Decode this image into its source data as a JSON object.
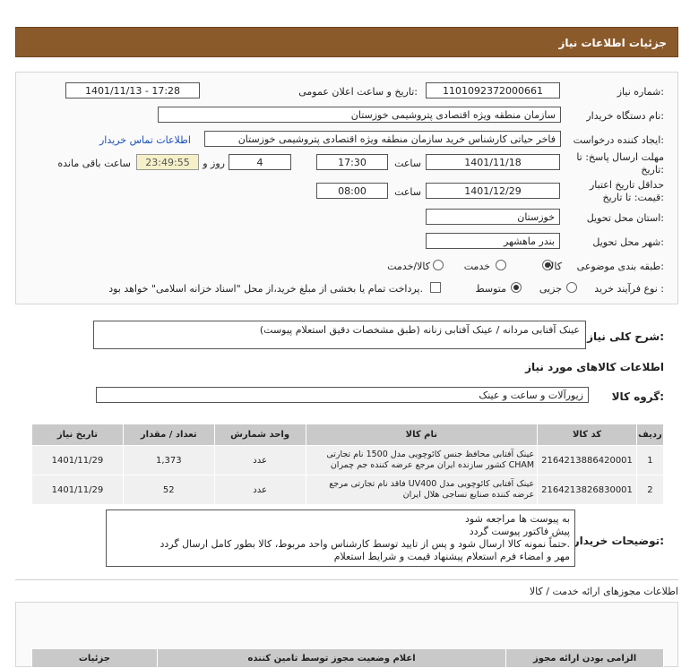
{
  "page": {
    "title": "جزئیات اطلاعات نیاز"
  },
  "form": {
    "need_number_label": "شماره نیاز:",
    "need_number": "1101092372000661",
    "announce_label": "تاریخ و ساعت اعلان عمومی:",
    "announce_value": "1401/11/13 - 17:28",
    "buyer_label": "نام دستگاه خریدار:",
    "buyer": "سازمان منطقه ویژه اقتصادی پتروشیمی خوزستان",
    "creator_label": "ایجاد کننده درخواست:",
    "creator": "فاخر حیاتی کارشناس خرید سازمان منطقه ویژه اقتصادی پتروشیمی خوزستان",
    "contact_link": "اطلاعات تماس خریدار",
    "deadline_label_1": "مهلت ارسال پاسخ: تا",
    "deadline_label_2": "تاریخ:",
    "deadline_date": "1401/11/18",
    "time_label": "ساعت",
    "deadline_time": "17:30",
    "days_value": "4",
    "days_label": "روز و",
    "remaining_time": "23:49:55",
    "remaining_label": "ساعت باقی مانده",
    "validity_label_1": "حداقل تاریخ اعتبار",
    "validity_label_2": "قیمت: تا تاریخ:",
    "validity_date": "1401/12/29",
    "validity_time": "08:00",
    "province_label": "استان محل تحویل:",
    "province": "خوزستان",
    "city_label": "شهر محل تحویل:",
    "city": "بندر ماهشهر",
    "category_label": "طبقه بندی موضوعی:",
    "category_options": [
      "کالا",
      "خدمت",
      "کالا/خدمت"
    ],
    "category_selected": "کالا",
    "process_label": "نوع فرآیند خرید :",
    "process_options": [
      "جزیی",
      "متوسط"
    ],
    "process_selected": "متوسط",
    "payment_note": "پرداخت تمام یا بخشی از مبلغ خرید،از محل \"اسناد خزانه اسلامی\" خواهد بود."
  },
  "summary": {
    "label": "شرح کلی نیاز:",
    "text": "عینک آفتابی مردانه / عینک آفتابی زنانه (طبق مشخصات دقیق استعلام پیوست)"
  },
  "goods": {
    "section_title": "اطلاعات کالاهای مورد نیاز",
    "group_label": "گروه کالا:",
    "group_value": "زیورآلات و ساعت و عینک",
    "columns": [
      "ردیف",
      "کد کالا",
      "نام کالا",
      "واحد شمارش",
      "تعداد / مقدار",
      "تاریخ نیاز"
    ],
    "rows": [
      {
        "row": "1",
        "code": "2164213886420001",
        "name": "عینک آفتابی محافظ جنس کائوچویی مدل 1500 نام تجارتی CHAM کشور سازنده ایران مرجع عرضه کننده جم چمران",
        "unit": "عدد",
        "qty": "1,373",
        "date": "1401/11/29"
      },
      {
        "row": "2",
        "code": "2164213826830001",
        "name": "عینک آفتابی کائوچویی مدل UV400 فاقد نام تجارتی مرجع عرضه کننده صنایع نساجی هلال ایران",
        "unit": "عدد",
        "qty": "52",
        "date": "1401/11/29"
      }
    ]
  },
  "notes": {
    "label": "توضیحات خریدار:",
    "lines": [
      "به پیوست ها مراجعه شود",
      "پیش فاکتور پیوست گردد",
      "حتماً نمونه کالا ارسال شود و پس از تایید توسط کارشناس واحد مربوط، کالا بطور کامل ارسال گردد.",
      "مهر و امضاء فرم استعلام پیشنهاد قیمت و شرایط استعلام"
    ]
  },
  "licenses": {
    "title": "اطلاعات مجوزهای ارائه خدمت / کالا",
    "columns": [
      "الزامی بودن ارائه مجوز",
      "اعلام وضعیت مجوز توسط تامین کننده",
      "جزئیات"
    ]
  }
}
